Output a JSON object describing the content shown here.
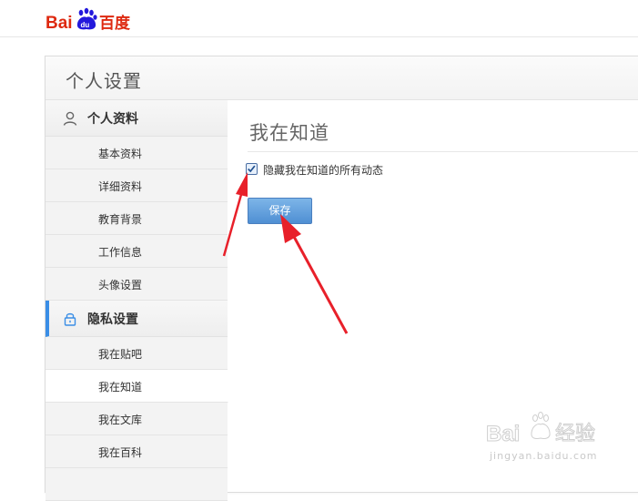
{
  "brand": {
    "logo_text": "Baidu百度"
  },
  "panel": {
    "title": "个人设置"
  },
  "sidebar": {
    "groups": [
      {
        "label": "个人资料",
        "icon": "user-icon",
        "items": [
          "基本资料",
          "详细资料",
          "教育背景",
          "工作信息",
          "头像设置"
        ]
      },
      {
        "label": "隐私设置",
        "icon": "lock-icon",
        "items": [
          "我在贴吧",
          "我在知道",
          "我在文库",
          "我在百科"
        ]
      }
    ],
    "selected_item": "我在知道"
  },
  "content": {
    "title": "我在知道",
    "checkbox_label": "隐藏我在知道的所有动态",
    "checkbox_checked": true,
    "save_label": "保存"
  },
  "watermark": {
    "text": "jingyan.baidu.com",
    "logo": "Bai经验"
  },
  "colors": {
    "accent": "#3a8ee6",
    "button": "#5b9bd8",
    "arrow": "#e8202a",
    "brand_red": "#de2910",
    "brand_blue": "#2319dc"
  }
}
